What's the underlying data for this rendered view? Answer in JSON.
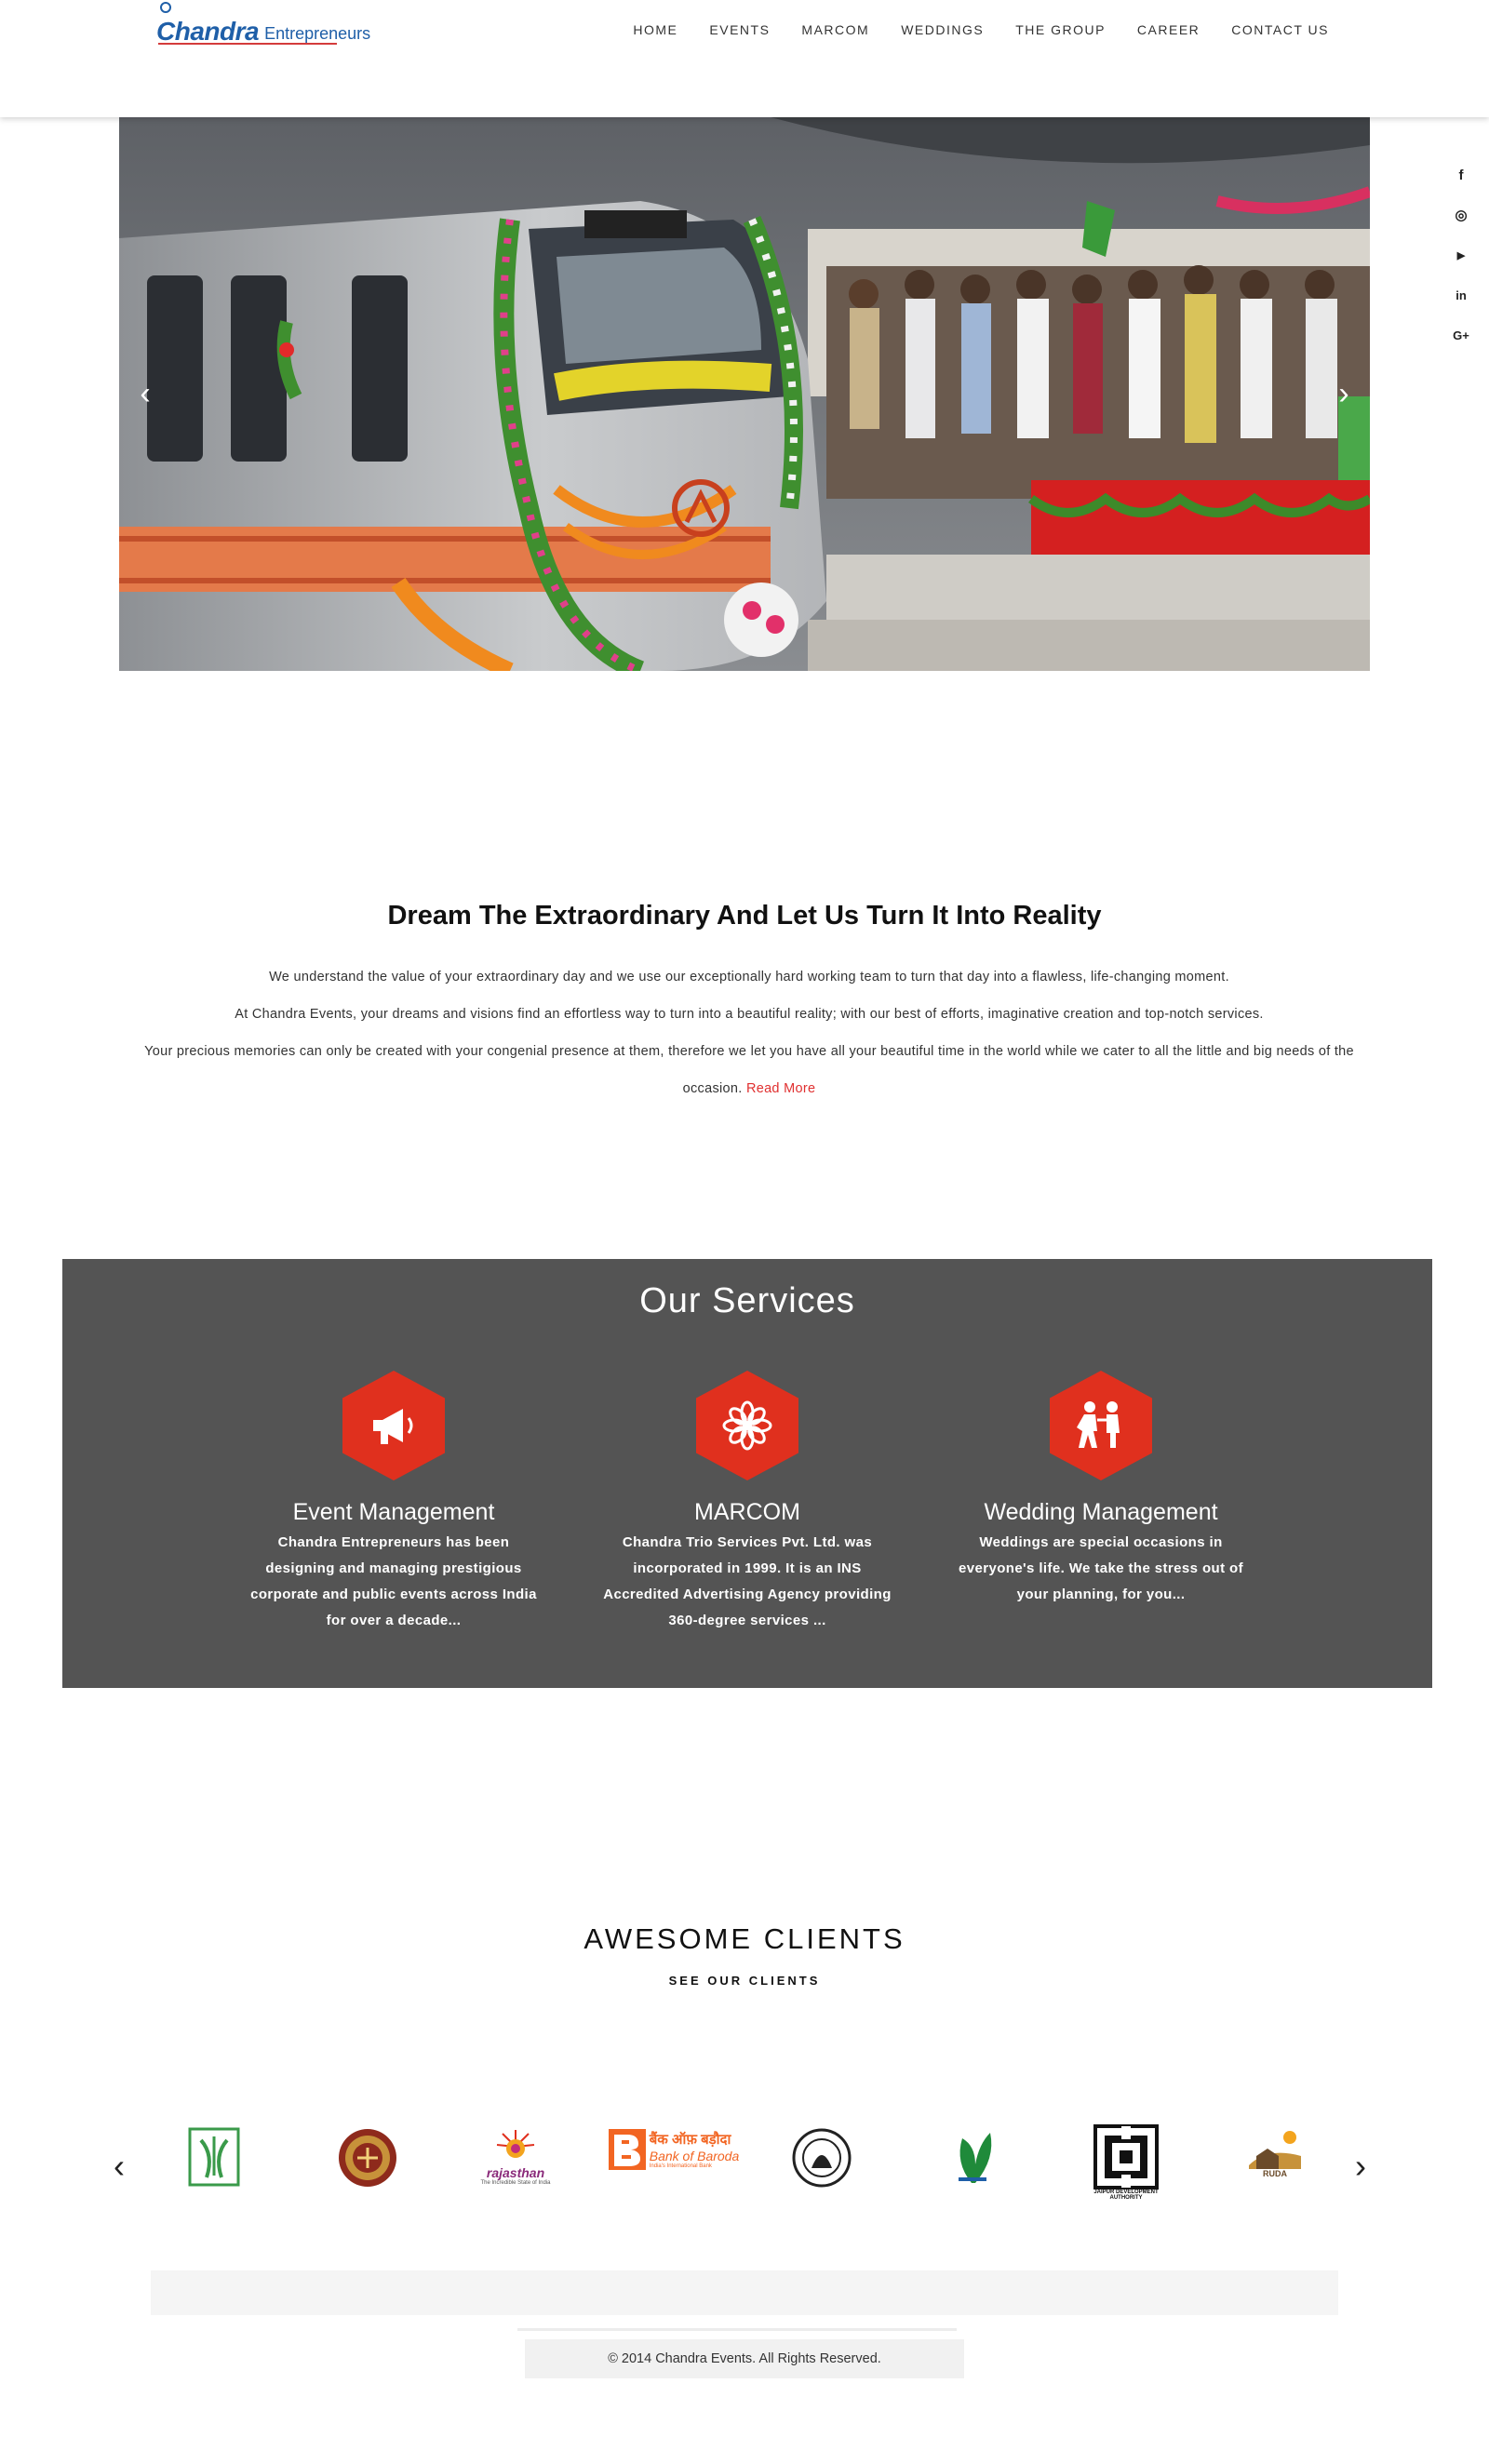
{
  "header": {
    "logo_main": "Chandra",
    "logo_sub": "Entrepreneurs",
    "nav": [
      "HOME",
      "EVENTS",
      "MARCOM",
      "WEDDINGS",
      "THE GROUP",
      "CAREER",
      "CONTACT US"
    ]
  },
  "hero": {
    "prev_arrow": "‹",
    "next_arrow": "›"
  },
  "social": {
    "facebook": "f",
    "instagram": "◎",
    "youtube": "▶",
    "linkedin": "in",
    "googleplus": "G+"
  },
  "intro": {
    "title": "Dream The Extraordinary And Let Us Turn It Into Reality",
    "line1": "We understand the value of your extraordinary day and we use our exceptionally hard working team to turn that day into a flawless, life-changing moment.",
    "line2": "At Chandra Events, your dreams and visions find an effortless way to turn into a beautiful reality; with our best of efforts, imaginative creation and top-notch services.",
    "line3": "Your precious memories can only be created with your congenial presence at them, therefore we let you have all your beautiful time in the world while we cater to all the little and big needs of the occasion.",
    "read_more": "Read More"
  },
  "services": {
    "title": "Our Services",
    "items": [
      {
        "title": "Event Management",
        "desc": "Chandra Entrepreneurs has been designing and managing prestigious corporate and public events across India for over a decade..."
      },
      {
        "title": "MARCOM",
        "desc": "Chandra Trio Services Pvt. Ltd. was incorporated in 1999. It is an INS Accredited Advertising Agency providing 360-degree services ..."
      },
      {
        "title": "Wedding Management",
        "desc": "Weddings are special occasions in everyone's life. We take the stress out of your planning, for you..."
      }
    ],
    "accent_color": "#e0301e"
  },
  "clients": {
    "title": "AWESOME CLIENTS",
    "subtitle": "SEE OUR CLIENTS",
    "prev_arrow": "‹",
    "next_arrow": "›",
    "logos": [
      {
        "name": "green-emblem-logo",
        "text": ""
      },
      {
        "name": "round-seal-logo",
        "text": ""
      },
      {
        "name": "rajasthan-tourism-logo",
        "text": "rajasthan",
        "tagline": "The Incredible State of India"
      },
      {
        "name": "bank-of-baroda-logo",
        "text": "Bank of Baroda",
        "hindi": "बैंक ऑफ़ बड़ौदा",
        "tagline": "India's International Bank"
      },
      {
        "name": "circular-emblem-logo",
        "text": ""
      },
      {
        "name": "leaf-logo",
        "text": ""
      },
      {
        "name": "jda-logo",
        "text": "JAIPUR DEVELOPMENT AUTHORITY"
      },
      {
        "name": "ruda-logo",
        "text": "RUDA"
      }
    ]
  },
  "footer": {
    "copyright": "© 2014 Chandra Events. All Rights Reserved."
  }
}
